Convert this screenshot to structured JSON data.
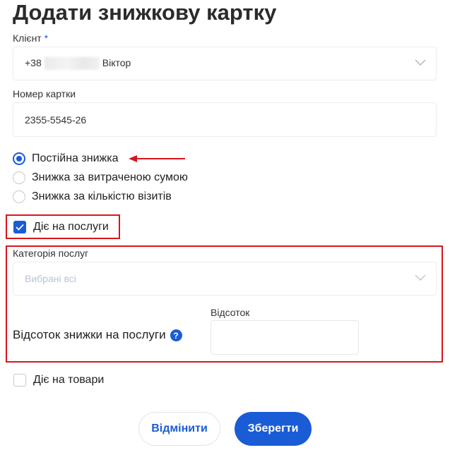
{
  "page": {
    "title": "Додати знижкову картку"
  },
  "client": {
    "label": "Клієнт",
    "required_mark": "*",
    "prefix": "+38",
    "name": "Віктор"
  },
  "card": {
    "label": "Номер картки",
    "value": "2355-5545-26"
  },
  "discount_type": {
    "options": [
      {
        "label": "Постійна знижка",
        "selected": true
      },
      {
        "label": "Знижка за витраченою сумою",
        "selected": false
      },
      {
        "label": "Знижка за кількістю візитів",
        "selected": false
      }
    ]
  },
  "services": {
    "checkbox_label": "Діє на послуги",
    "checked": true,
    "category_label": "Категорія послуг",
    "category_placeholder": "Вибрані всі",
    "percent_heading": "Відсоток знижки на послуги",
    "help_glyph": "?",
    "percent_label": "Відсоток",
    "percent_value": ""
  },
  "goods": {
    "checkbox_label": "Діє на товари",
    "checked": false
  },
  "actions": {
    "cancel_label": "Відмінити",
    "save_label": "Зберегти"
  },
  "colors": {
    "accent": "#1a5cd6",
    "highlight": "#d8151b"
  },
  "icons": {
    "dropdown": "chevron-down-icon",
    "check": "check-icon",
    "help": "question-circle-icon",
    "annotation": "arrow-left-icon"
  }
}
